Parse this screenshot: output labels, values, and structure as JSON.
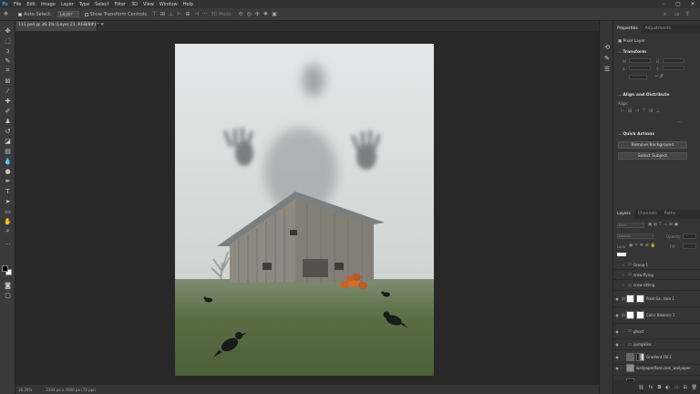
{
  "menubar": {
    "items": [
      "File",
      "Edit",
      "Image",
      "Layer",
      "Type",
      "Select",
      "Filter",
      "3D",
      "View",
      "Window",
      "Help"
    ]
  },
  "optbar": {
    "auto_select": "Auto-Select:",
    "target": "Layer",
    "show_transform": "Show Transform Controls",
    "mode3d": "3D Mode:"
  },
  "document": {
    "tab_title": "111.psd @ 36.3% (Layer 21, RGB/8#) *",
    "zoom": "36.29%",
    "dimensions": "2344 px x 3000 px (72 ppi)"
  },
  "properties": {
    "tabs": [
      "Properties",
      "Adjustments"
    ],
    "kind": "Pixel Layer",
    "transform": "Transform",
    "align": "Align and Distribute",
    "align_sub": "Align:",
    "quick_actions": "Quick Actions",
    "remove_bg": "Remove Background",
    "select_subject": "Select Subject",
    "w": "W",
    "h": "H",
    "x": "X",
    "y": "Y"
  },
  "layers": {
    "tabs": [
      "Layers",
      "Channels",
      "Paths"
    ],
    "kind": "Kind",
    "blend": "Normal",
    "opacity": "Opacity:",
    "lock": "Lock:",
    "fill": "Fill:",
    "items": [
      {
        "name": "Group 1",
        "type": "group",
        "visible": false
      },
      {
        "name": "crow flying",
        "type": "group",
        "visible": false
      },
      {
        "name": "crow sitting",
        "type": "group",
        "visible": false
      },
      {
        "name": "Pixel Sa...tion 1",
        "type": "adj",
        "visible": true
      },
      {
        "name": "Color Balance 1",
        "type": "adj",
        "visible": true
      },
      {
        "name": "ghost",
        "type": "group",
        "visible": true
      },
      {
        "name": "pumpkins",
        "type": "group",
        "visible": true
      },
      {
        "name": "Gradient Fill 1",
        "type": "fill",
        "visible": true
      },
      {
        "name": "wallpaperflare.com_wallpaper",
        "type": "image",
        "visible": true
      },
      {
        "name": "Layer 0",
        "type": "black",
        "visible": true
      }
    ]
  }
}
